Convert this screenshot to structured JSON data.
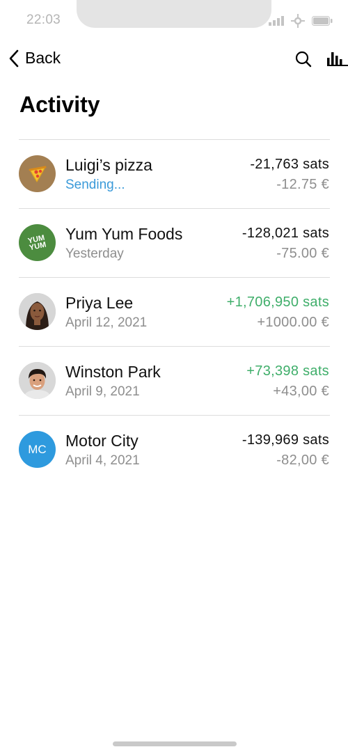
{
  "status_bar": {
    "time": "22:03"
  },
  "nav": {
    "back_label": "Back"
  },
  "page": {
    "title": "Activity"
  },
  "colors": {
    "positive": "#3fae6a",
    "sending": "#3a9ad9",
    "secondary": "#8e8e8e"
  },
  "activities": [
    {
      "name": "Luigi’s pizza",
      "subtitle": "Sending...",
      "amount_sats": "-21,763 sats",
      "amount_fiat": "-12.75 €",
      "avatar": "pizza-icon"
    },
    {
      "name": "Yum Yum Foods",
      "subtitle": "Yesterday",
      "amount_sats": "-128,021 sats",
      "amount_fiat": "-75.00 €",
      "avatar": "yum-yum-logo",
      "logo_text_1": "YUM",
      "logo_text_2": "YUM"
    },
    {
      "name": "Priya Lee",
      "subtitle": "April 12, 2021",
      "amount_sats": "+1,706,950 sats",
      "amount_fiat": "+1000.00 €",
      "avatar": "person-photo"
    },
    {
      "name": "Winston Park",
      "subtitle": "April 9, 2021",
      "amount_sats": "+73,398 sats",
      "amount_fiat": "+43,00 €",
      "avatar": "person-photo"
    },
    {
      "name": "Motor City",
      "subtitle": "April 4, 2021",
      "amount_sats": "-139,969 sats",
      "amount_fiat": "-82,00 €",
      "avatar": "initials",
      "initials": "MC"
    }
  ]
}
